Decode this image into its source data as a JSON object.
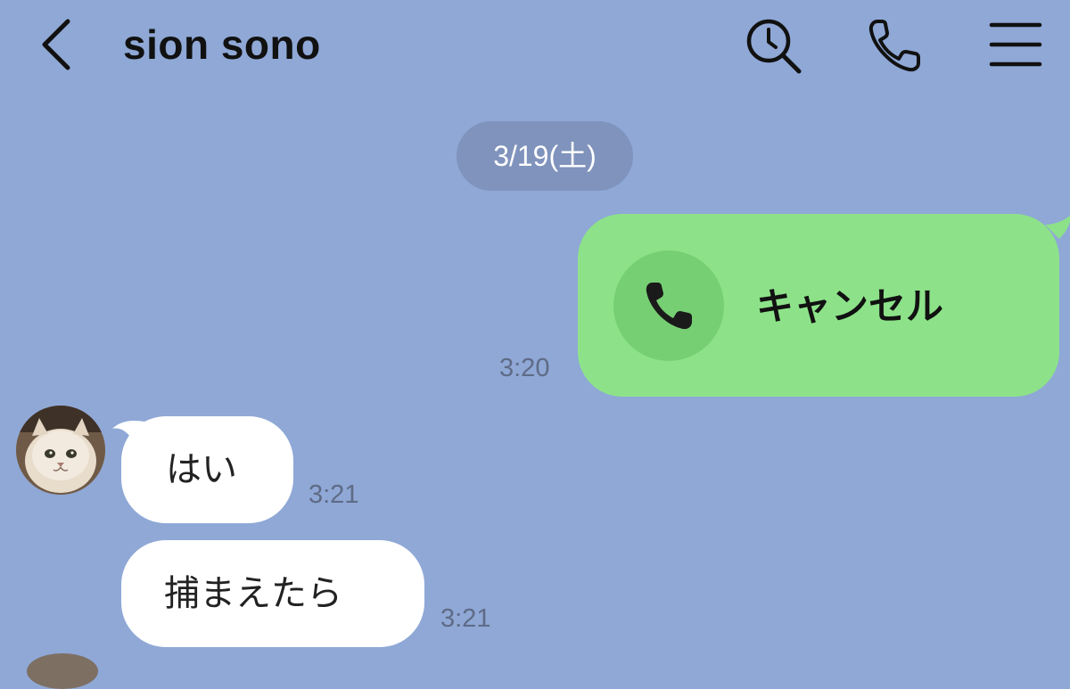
{
  "header": {
    "title": "sion sono",
    "icons": [
      "back-chevron-icon",
      "search-clock-icon",
      "phone-icon",
      "menu-icon"
    ]
  },
  "date_separator": "3/19(土)",
  "messages": [
    {
      "type": "call",
      "side": "right",
      "label": "キャンセル",
      "time": "3:20",
      "icon": "phone-icon",
      "bubble_color": "#8de289"
    },
    {
      "type": "text",
      "side": "left",
      "text": "はい",
      "time": "3:21",
      "avatar": "cat-avatar"
    },
    {
      "type": "text",
      "side": "left",
      "text": "捕まえたら",
      "time": "3:21"
    }
  ],
  "colors": {
    "background": "#8fa8d6",
    "sent_bubble": "#8de289",
    "received_bubble": "#ffffff",
    "date_pill": "#7f93bc"
  }
}
